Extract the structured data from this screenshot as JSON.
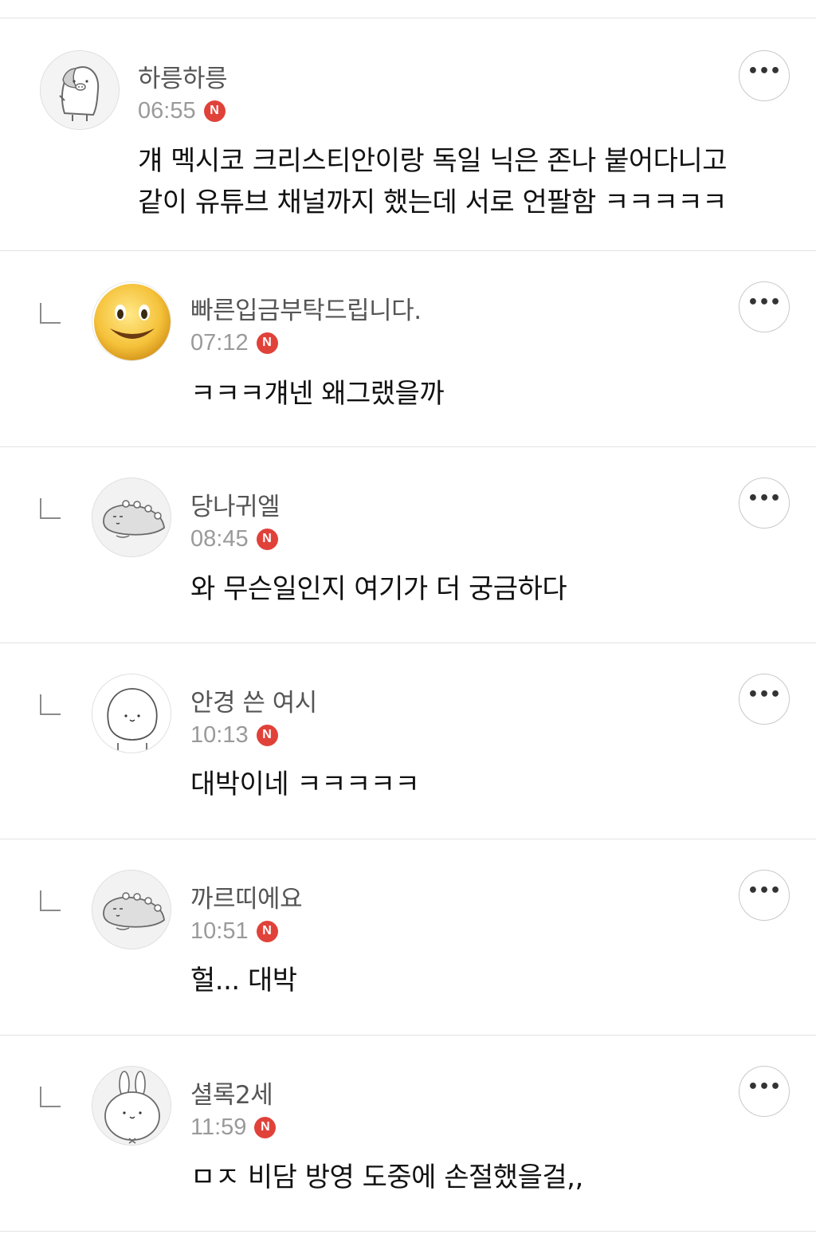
{
  "comments": [
    {
      "nickname": "하릉하릉",
      "time": "06:55",
      "badge": "N",
      "text": "걔 멕시코 크리스티안이랑 독일 닉은 존나 붙어다니고\n같이 유튜브 채널까지 했는데 서로 언팔함 ㅋㅋㅋㅋㅋ",
      "avatar": "penguin-pig-avatar",
      "more_label": "•••",
      "is_reply": false
    },
    {
      "nickname": "빠른입금부탁드립니다.",
      "time": "07:12",
      "badge": "N",
      "text": "ㅋㅋㅋ걔넨 왜그랬을까",
      "avatar": "smiley-avatar",
      "more_label": "•••",
      "is_reply": true
    },
    {
      "nickname": "당나귀엘",
      "time": "08:45",
      "badge": "N",
      "text": "와 무슨일인지 여기가 더 궁금하다",
      "avatar": "dinosaur-avatar",
      "more_label": "•••",
      "is_reply": true
    },
    {
      "nickname": "안경 쓴 여시",
      "time": "10:13",
      "badge": "N",
      "text": "대박이네 ㅋㅋㅋㅋㅋ",
      "avatar": "blob-face-avatar",
      "more_label": "•••",
      "is_reply": true
    },
    {
      "nickname": "까르띠에요",
      "time": "10:51",
      "badge": "N",
      "text": "헐... 대박",
      "avatar": "dinosaur-avatar",
      "more_label": "•••",
      "is_reply": true
    },
    {
      "nickname": "셜록2세",
      "time": "11:59",
      "badge": "N",
      "text": "ㅁㅈ 비담 방영 도중에 손절했을걸,,",
      "avatar": "bunny-avatar",
      "more_label": "•••",
      "is_reply": true
    }
  ],
  "colors": {
    "badge": "#e0423a",
    "nickname": "#555555",
    "time": "#9a9a9a",
    "divider": "#e3e3e3"
  }
}
